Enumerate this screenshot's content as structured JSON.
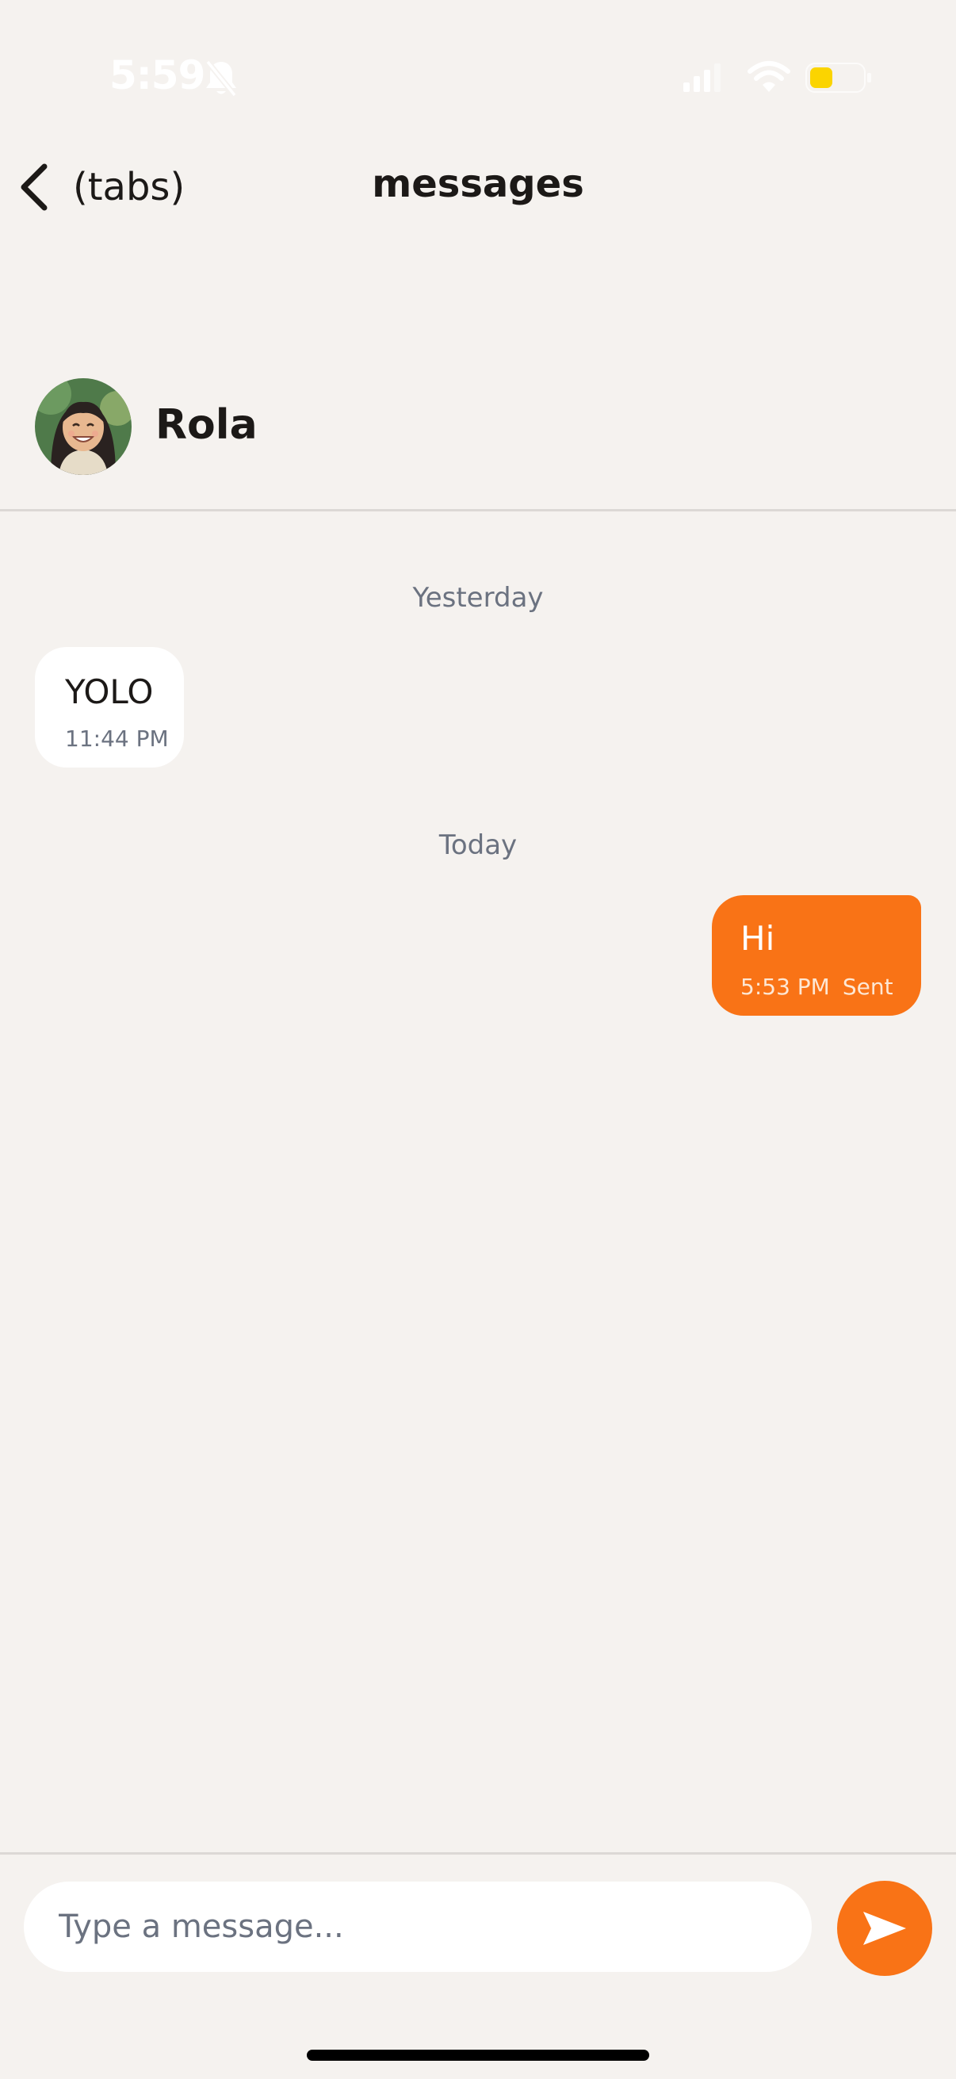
{
  "status_bar": {
    "time": "5:59",
    "icons": [
      "bell-muted-icon",
      "cell-signal-icon",
      "wifi-icon",
      "battery-icon"
    ],
    "battery_color": "#fbd400"
  },
  "nav": {
    "back_label": "(tabs)",
    "title": "messages"
  },
  "contact": {
    "name": "Rola"
  },
  "messages": [
    {
      "date_separator": "Yesterday",
      "text": "YOLO",
      "time": "11:44 PM",
      "direction": "incoming"
    },
    {
      "date_separator": "Today",
      "text": "Hi",
      "time": "5:53 PM",
      "status": "Sent",
      "direction": "outgoing"
    }
  ],
  "composer": {
    "placeholder": "Type a message...",
    "send_icon": "send-icon"
  },
  "colors": {
    "background": "#f5f2ef",
    "accent": "#f97316",
    "incoming_bubble": "#ffffff",
    "muted_text": "#6b7280"
  }
}
